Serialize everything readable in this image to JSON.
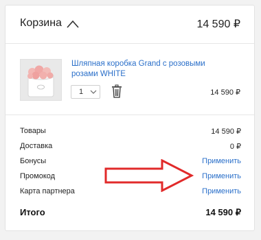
{
  "cart": {
    "title": "Корзина",
    "total": "14 590 ₽"
  },
  "item": {
    "name": "Шляпная коробка Grand с розовыми розами WHITE",
    "quantity": "1",
    "price": "14 590 ₽"
  },
  "summary": {
    "goods_label": "Товары",
    "goods_value": "14 590 ₽",
    "delivery_label": "Доставка",
    "delivery_value": "0 ₽",
    "bonuses_label": "Бонусы",
    "bonuses_action": "Применить",
    "promo_label": "Промокод",
    "promo_action": "Применить",
    "partner_label": "Карта партнера",
    "partner_action": "Применить",
    "total_label": "Итого",
    "total_value": "14 590 ₽"
  },
  "colors": {
    "link": "#2a6fc9",
    "annotation_arrow": "#e12a2a"
  },
  "icons": [
    "chevron-up-icon",
    "chevron-down-icon",
    "trash-icon",
    "red-arrow-annotation"
  ]
}
